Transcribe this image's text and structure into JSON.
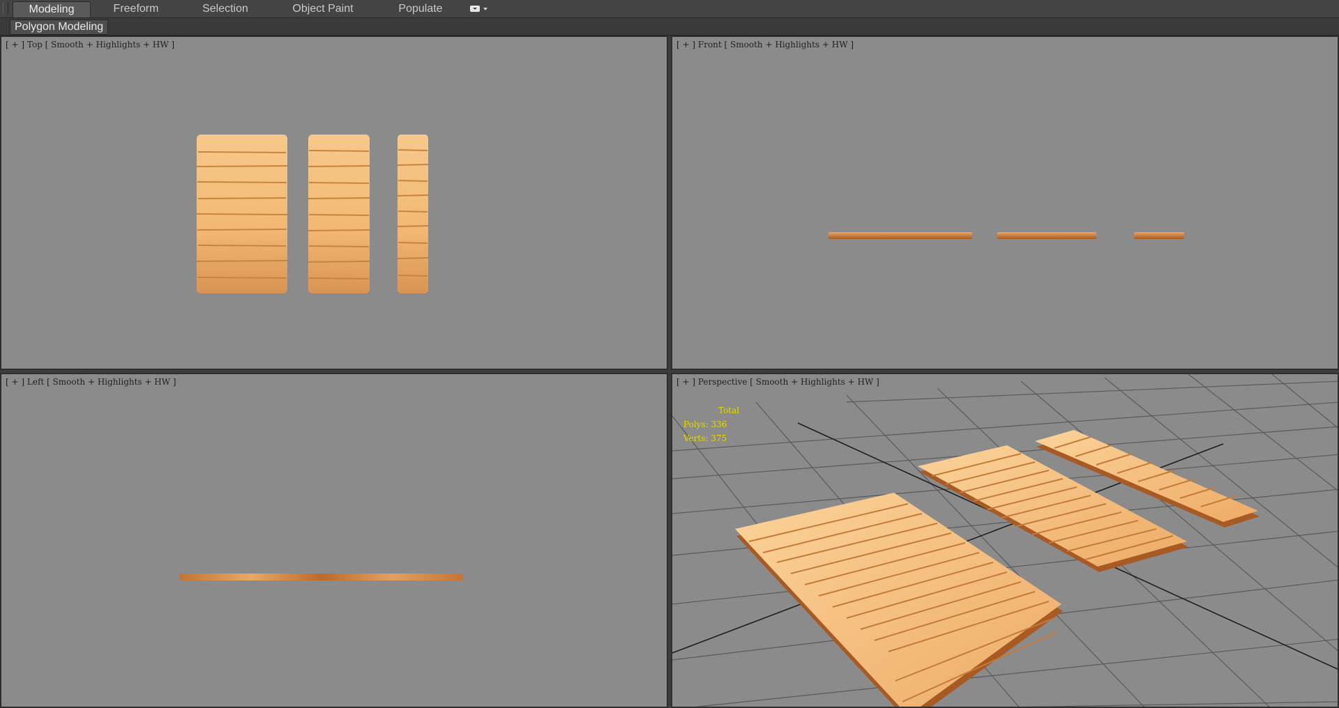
{
  "ribbon": {
    "tabs": [
      {
        "label": "Modeling",
        "active": true
      },
      {
        "label": "Freeform",
        "active": false
      },
      {
        "label": "Selection",
        "active": false
      },
      {
        "label": "Object Paint",
        "active": false
      },
      {
        "label": "Populate",
        "active": false
      }
    ],
    "menu_icon": "ribbon-options-icon",
    "panel_label": "Polygon Modeling"
  },
  "viewports": {
    "top": {
      "label": [
        "[ + ] ",
        "Top",
        " [ ",
        "Smooth + Highlights + HW",
        " ]"
      ]
    },
    "front": {
      "label": [
        "[ + ] ",
        "Front",
        " [ ",
        "Smooth + Highlights + HW",
        " ]"
      ]
    },
    "left": {
      "label": [
        "[ + ] ",
        "Left",
        " [ ",
        "Smooth + Highlights + HW",
        " ]"
      ]
    },
    "perspective": {
      "label": [
        "[ + ] ",
        "Perspective",
        " [ ",
        "Smooth + Highlights + HW",
        " ]"
      ],
      "stats": {
        "header": "Total",
        "polys_label": "Polys:",
        "polys": "336",
        "verts_label": "Verts:",
        "verts": "375"
      }
    }
  },
  "colors": {
    "viewport_bg": "#8b8b8b",
    "wood_light": "#f4c07e",
    "wood_mid": "#e8a35e",
    "wood_dark": "#b8692c",
    "stats_text": "#e6d800"
  }
}
